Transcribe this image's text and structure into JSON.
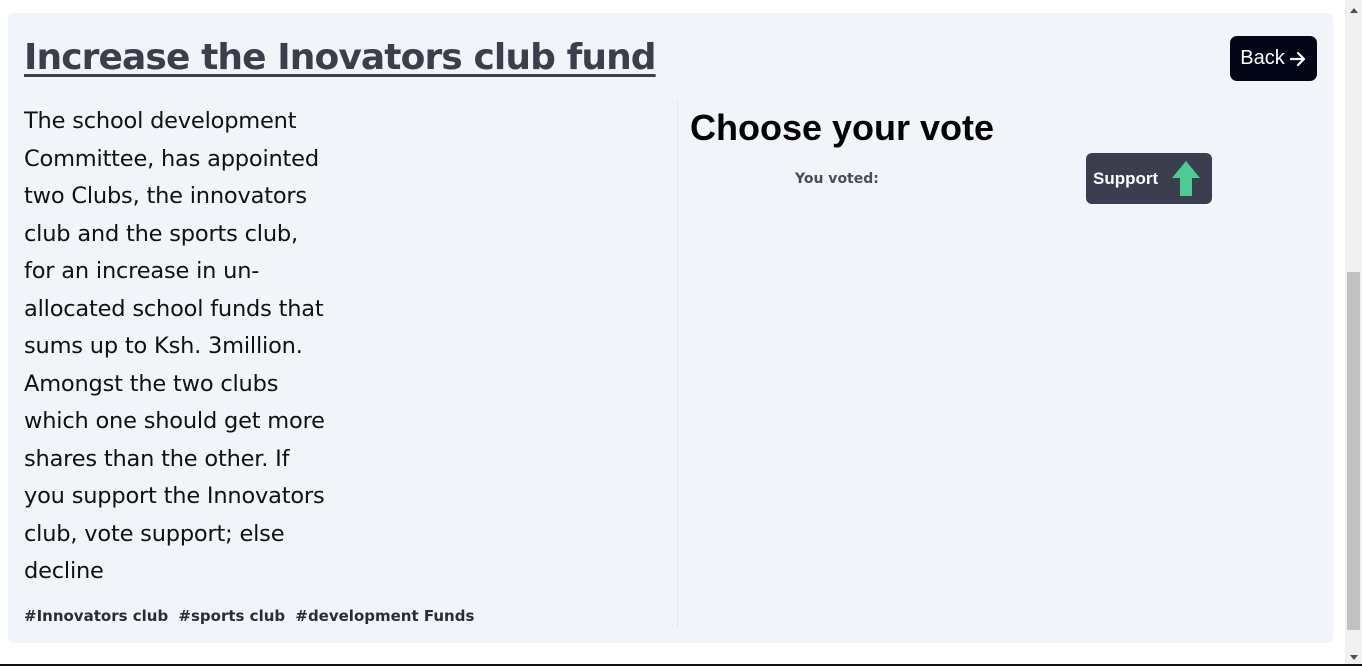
{
  "proposal": {
    "title": "Increase the Inovators club fund",
    "back_label": "Back",
    "description_lines": [
      "The school development",
      "Committee, has appointed",
      "two Clubs, the innovators",
      "club and the sports club,",
      "for an increase in un-",
      "allocated school funds that",
      "sums up to Ksh. 3million.",
      "Amongst the two clubs",
      "which one should get more",
      "shares than the other. If",
      "you support the Innovators",
      "club, vote support; else",
      "decline"
    ],
    "tags": [
      "#Innovators club",
      "#sports club",
      "#development Funds"
    ]
  },
  "vote": {
    "heading": "Choose your vote",
    "voted_label": "You voted:",
    "choice_label": "Support",
    "choice_icon": "arrow-up-icon"
  },
  "colors": {
    "card_background": "#f1f4f8",
    "back_button": "#020617",
    "support_button": "#3a3e4e",
    "support_arrow": "#4ecb93"
  }
}
